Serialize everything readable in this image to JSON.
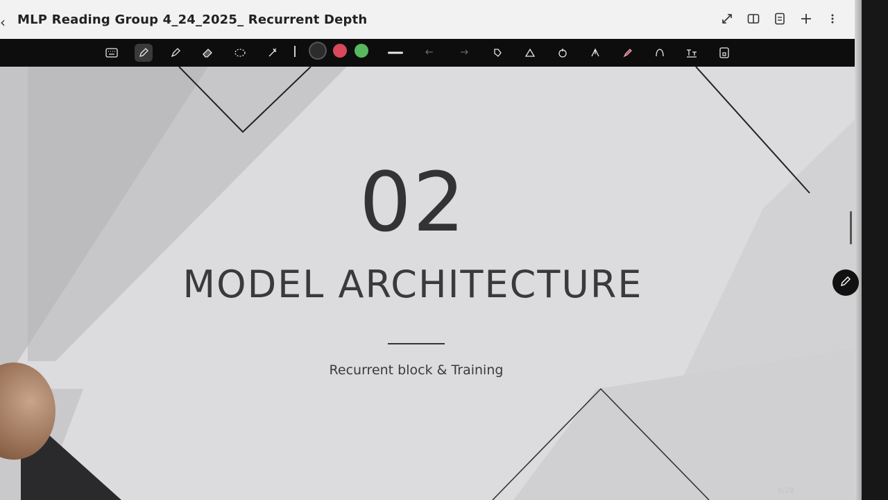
{
  "header": {
    "title": "MLP Reading Group 4_24_2025_ Recurrent Depth",
    "icons": [
      "back-icon",
      "expand-icon",
      "split-view-icon",
      "pages-icon",
      "add-icon",
      "more-icon"
    ]
  },
  "toolbar": {
    "tools": [
      "keyboard-icon",
      "pen-icon",
      "highlighter-icon",
      "eraser-icon",
      "lasso-icon",
      "magic-icon",
      "undo-icon",
      "redo-icon",
      "shape-icon",
      "laser-icon",
      "ink-icon",
      "arrow-icon",
      "marker-icon",
      "text-icon",
      "text-box-icon",
      "lock-icon"
    ],
    "colors": {
      "black": "#2c2c2c",
      "red": "#d9475a",
      "green": "#57b85f"
    }
  },
  "slide": {
    "number": "02",
    "heading": "MODEL ARCHITECTURE",
    "subtitle": "Recurrent block & Training",
    "page_indicator": "9/28"
  }
}
